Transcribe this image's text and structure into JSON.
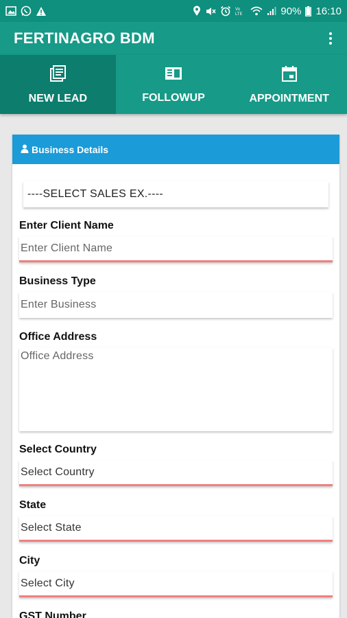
{
  "status_bar": {
    "left_icons": [
      "image-icon",
      "whatsapp-icon",
      "warning-icon"
    ],
    "right_icons": [
      "location-icon",
      "mute-icon",
      "alarm-icon",
      "volte-icon",
      "wifi-icon",
      "signal-icon"
    ],
    "battery": "90%",
    "time": "16:10"
  },
  "app_bar": {
    "title": "FERTINAGRO BDM"
  },
  "tabs": [
    {
      "label": "NEW LEAD",
      "icon": "list-icon",
      "active": true
    },
    {
      "label": "FOLLOWUP",
      "icon": "news-icon",
      "active": false
    },
    {
      "label": "APPOINTMENT",
      "icon": "calendar-icon",
      "active": false
    }
  ],
  "colors": {
    "primary": "#179a88",
    "primary_dark": "#0f8f7d",
    "active_tab": "#0d7d6d",
    "section_header": "#1b9bd7",
    "error_underline": "#f08080"
  },
  "form": {
    "section_title": "Business Details",
    "sales_ex_select": "----SELECT SALES EX.----",
    "client_name": {
      "label": "Enter Client Name",
      "placeholder": "Enter Client Name"
    },
    "business_type": {
      "label": "Business Type",
      "placeholder": "Enter Business"
    },
    "office_address": {
      "label": "Office Address",
      "placeholder": "Office Address"
    },
    "country": {
      "label": "Select Country",
      "value": "Select Country"
    },
    "state": {
      "label": "State",
      "value": "Select State"
    },
    "city": {
      "label": "City",
      "value": "Select City"
    },
    "gst": {
      "label": "GST Number"
    }
  }
}
